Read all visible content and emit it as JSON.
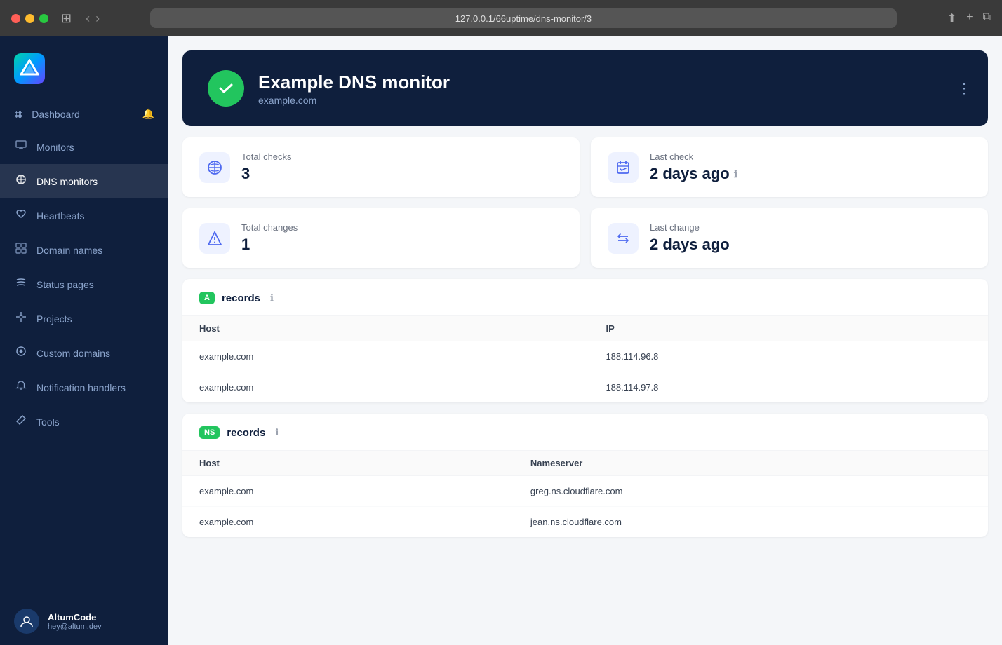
{
  "browser": {
    "url": "127.0.0.1/66uptime/dns-monitor/3",
    "nav_back": "‹",
    "nav_forward": "›"
  },
  "sidebar": {
    "logo_alt": "Altum Logo",
    "items": [
      {
        "id": "dashboard",
        "label": "Dashboard",
        "icon": "▦",
        "active": false
      },
      {
        "id": "monitors",
        "label": "Monitors",
        "icon": "▤",
        "active": false
      },
      {
        "id": "dns-monitors",
        "label": "DNS monitors",
        "icon": "⚡",
        "active": true
      },
      {
        "id": "heartbeats",
        "label": "Heartbeats",
        "icon": "♡",
        "active": false
      },
      {
        "id": "domain-names",
        "label": "Domain names",
        "icon": "⊞",
        "active": false
      },
      {
        "id": "status-pages",
        "label": "Status pages",
        "icon": "☰",
        "active": false
      },
      {
        "id": "projects",
        "label": "Projects",
        "icon": "⊕",
        "active": false
      },
      {
        "id": "custom-domains",
        "label": "Custom domains",
        "icon": "⊕",
        "active": false
      },
      {
        "id": "notification-handlers",
        "label": "Notification handlers",
        "icon": "🔔",
        "active": false
      },
      {
        "id": "tools",
        "label": "Tools",
        "icon": "✕",
        "active": false
      }
    ],
    "user": {
      "name": "AltumCode",
      "email": "hey@altum.dev"
    }
  },
  "monitor": {
    "title": "Example DNS monitor",
    "subtitle": "example.com",
    "status": "up",
    "status_icon": "✓"
  },
  "stats": {
    "total_checks_label": "Total checks",
    "total_checks_value": "3",
    "last_check_label": "Last check",
    "last_check_value": "2 days ago",
    "total_changes_label": "Total changes",
    "total_changes_value": "1",
    "last_change_label": "Last change",
    "last_change_value": "2 days ago"
  },
  "a_records": {
    "badge": "A",
    "title": "records",
    "columns": [
      "Host",
      "IP"
    ],
    "rows": [
      {
        "host": "example.com",
        "value": "188.114.96.8"
      },
      {
        "host": "example.com",
        "value": "188.114.97.8"
      }
    ]
  },
  "ns_records": {
    "badge": "NS",
    "title": "records",
    "columns": [
      "Host",
      "Nameserver"
    ],
    "rows": [
      {
        "host": "example.com",
        "value": "greg.ns.cloudflare.com"
      },
      {
        "host": "example.com",
        "value": "jean.ns.cloudflare.com"
      }
    ]
  }
}
